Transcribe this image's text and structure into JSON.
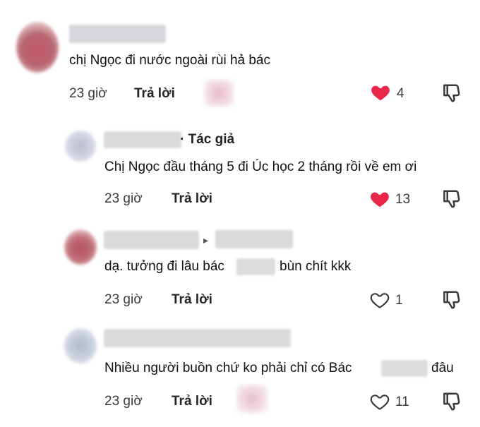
{
  "comments": [
    {
      "text": "chị Ngọc đi nước ngoài rùi hả bác",
      "time": "23 giờ",
      "reply_label": "Trả lời",
      "likes": "4",
      "liked": true
    },
    {
      "author_tag": "· Tác giả",
      "text": "Chị Ngọc đầu tháng 5 đi Úc học 2 tháng rồi về em ơi",
      "time": "23 giờ",
      "reply_label": "Trả lời",
      "likes": "13",
      "liked": true
    },
    {
      "reply_arrow": "▸",
      "text_before": "dạ. tưởng đi lâu bác",
      "text_after": "bùn chít kkk",
      "time": "23 giờ",
      "reply_label": "Trả lời",
      "likes": "1",
      "liked": false
    },
    {
      "text_before": "Nhiều người buồn chứ ko phải chỉ có Bác",
      "text_after": "đâu",
      "time": "23 giờ",
      "reply_label": "Trả lời",
      "likes": "11",
      "liked": false
    }
  ],
  "colors": {
    "heart_liked": "#e8274b",
    "icon_gray": "#3a3a3a",
    "blur_gray": "#d9d9dc"
  }
}
